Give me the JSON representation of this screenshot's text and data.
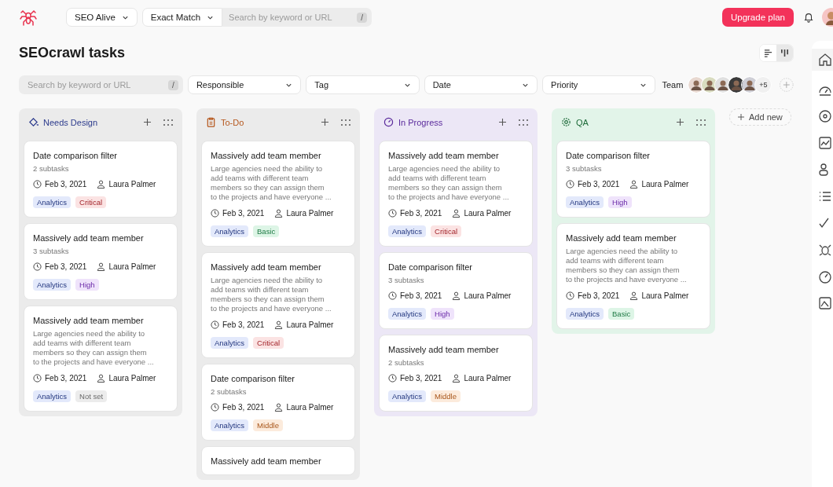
{
  "topbar": {
    "project": "SEO Alive",
    "match_mode": "Exact Match",
    "search": {
      "placeholder": "Search by keyword or URL",
      "shortcut": "/"
    },
    "upgrade_button": "Upgrade plan"
  },
  "page": {
    "title": "SEOcrawl tasks",
    "views": [
      {
        "kind": "list",
        "selected": false
      },
      {
        "kind": "board",
        "selected": true
      }
    ]
  },
  "filters": {
    "search": {
      "placeholder": "Search by keyword or URL",
      "shortcut": "/"
    },
    "dropdowns": [
      "Responsible",
      "Tag",
      "Date",
      "Priority"
    ],
    "team_label": "Team",
    "team_count": "+5"
  },
  "columns": [
    {
      "kind": "design",
      "name": "Needs Design",
      "cards": [
        {
          "title": "Date comparison filter",
          "subtasks": "2 subtasks",
          "date": "Feb 3, 2021",
          "assignee": "Laura Palmer",
          "tags": [
            {
              "text": "Analytics",
              "kind": "category"
            },
            {
              "text": "Critical",
              "kind": "critical"
            }
          ]
        },
        {
          "title": "Massively add team member",
          "subtasks": "3 subtasks",
          "date": "Feb 3, 2021",
          "assignee": "Laura Palmer",
          "tags": [
            {
              "text": "Analytics",
              "kind": "category"
            },
            {
              "text": "High",
              "kind": "high"
            }
          ]
        },
        {
          "title": "Massively add team member",
          "description": "Large agencies need the ability to add teams with different team members so they can assign them to the projects and have everyone ...",
          "date": "Feb 3, 2021",
          "assignee": "Laura Palmer",
          "tags": [
            {
              "text": "Analytics",
              "kind": "category"
            },
            {
              "text": "Not set",
              "kind": "unset"
            }
          ]
        }
      ]
    },
    {
      "kind": "todo",
      "name": "To-Do",
      "cards": [
        {
          "title": "Massively add team member",
          "description": "Large agencies need the ability to add teams with different team members so they can assign them to the projects and have everyone ...",
          "date": "Feb 3, 2021",
          "assignee": "Laura Palmer",
          "tags": [
            {
              "text": "Analytics",
              "kind": "category"
            },
            {
              "text": "Basic",
              "kind": "basic"
            }
          ]
        },
        {
          "title": "Massively add team member",
          "description": "Large agencies need the ability to add teams with different team members so they can assign them to the projects and have everyone ...",
          "date": "Feb 3, 2021",
          "assignee": "Laura Palmer",
          "tags": [
            {
              "text": "Analytics",
              "kind": "category"
            },
            {
              "text": "Critical",
              "kind": "critical"
            }
          ]
        },
        {
          "title": "Date comparison filter",
          "subtasks": "2 subtasks",
          "date": "Feb 3, 2021",
          "assignee": "Laura Palmer",
          "tags": [
            {
              "text": "Analytics",
              "kind": "category"
            },
            {
              "text": "Middle",
              "kind": "middle"
            }
          ]
        },
        {
          "title": "Massively add team member"
        }
      ]
    },
    {
      "kind": "progress",
      "name": "In Progress",
      "cards": [
        {
          "title": "Massively add team member",
          "description": "Large agencies need the ability to add teams with different team members so they can assign them to the projects and have everyone ...",
          "date": "Feb 3, 2021",
          "assignee": "Laura Palmer",
          "tags": [
            {
              "text": "Analytics",
              "kind": "category"
            },
            {
              "text": "Critical",
              "kind": "critical"
            }
          ]
        },
        {
          "title": "Date comparison filter",
          "subtasks": "3 subtasks",
          "date": "Feb 3, 2021",
          "assignee": "Laura Palmer",
          "tags": [
            {
              "text": "Analytics",
              "kind": "category"
            },
            {
              "text": "High",
              "kind": "high"
            }
          ]
        },
        {
          "title": "Massively add team member",
          "subtasks": "2 subtasks",
          "date": "Feb 3, 2021",
          "assignee": "Laura Palmer",
          "tags": [
            {
              "text": "Analytics",
              "kind": "category"
            },
            {
              "text": "Middle",
              "kind": "middle"
            }
          ]
        }
      ]
    },
    {
      "kind": "qa",
      "name": "QA",
      "cards": [
        {
          "title": "Date comparison filter",
          "subtasks": "3 subtasks",
          "date": "Feb 3, 2021",
          "assignee": "Laura Palmer",
          "tags": [
            {
              "text": "Analytics",
              "kind": "category"
            },
            {
              "text": "High",
              "kind": "high"
            }
          ]
        },
        {
          "title": "Massively add team member",
          "description": "Large agencies need the ability to add teams with different team members so they can assign them to the projects and have everyone ...",
          "date": "Feb 3, 2021",
          "assignee": "Laura Palmer",
          "tags": [
            {
              "text": "Analytics",
              "kind": "category"
            },
            {
              "text": "Basic",
              "kind": "basic"
            }
          ]
        }
      ]
    }
  ],
  "add_column": "Add new"
}
